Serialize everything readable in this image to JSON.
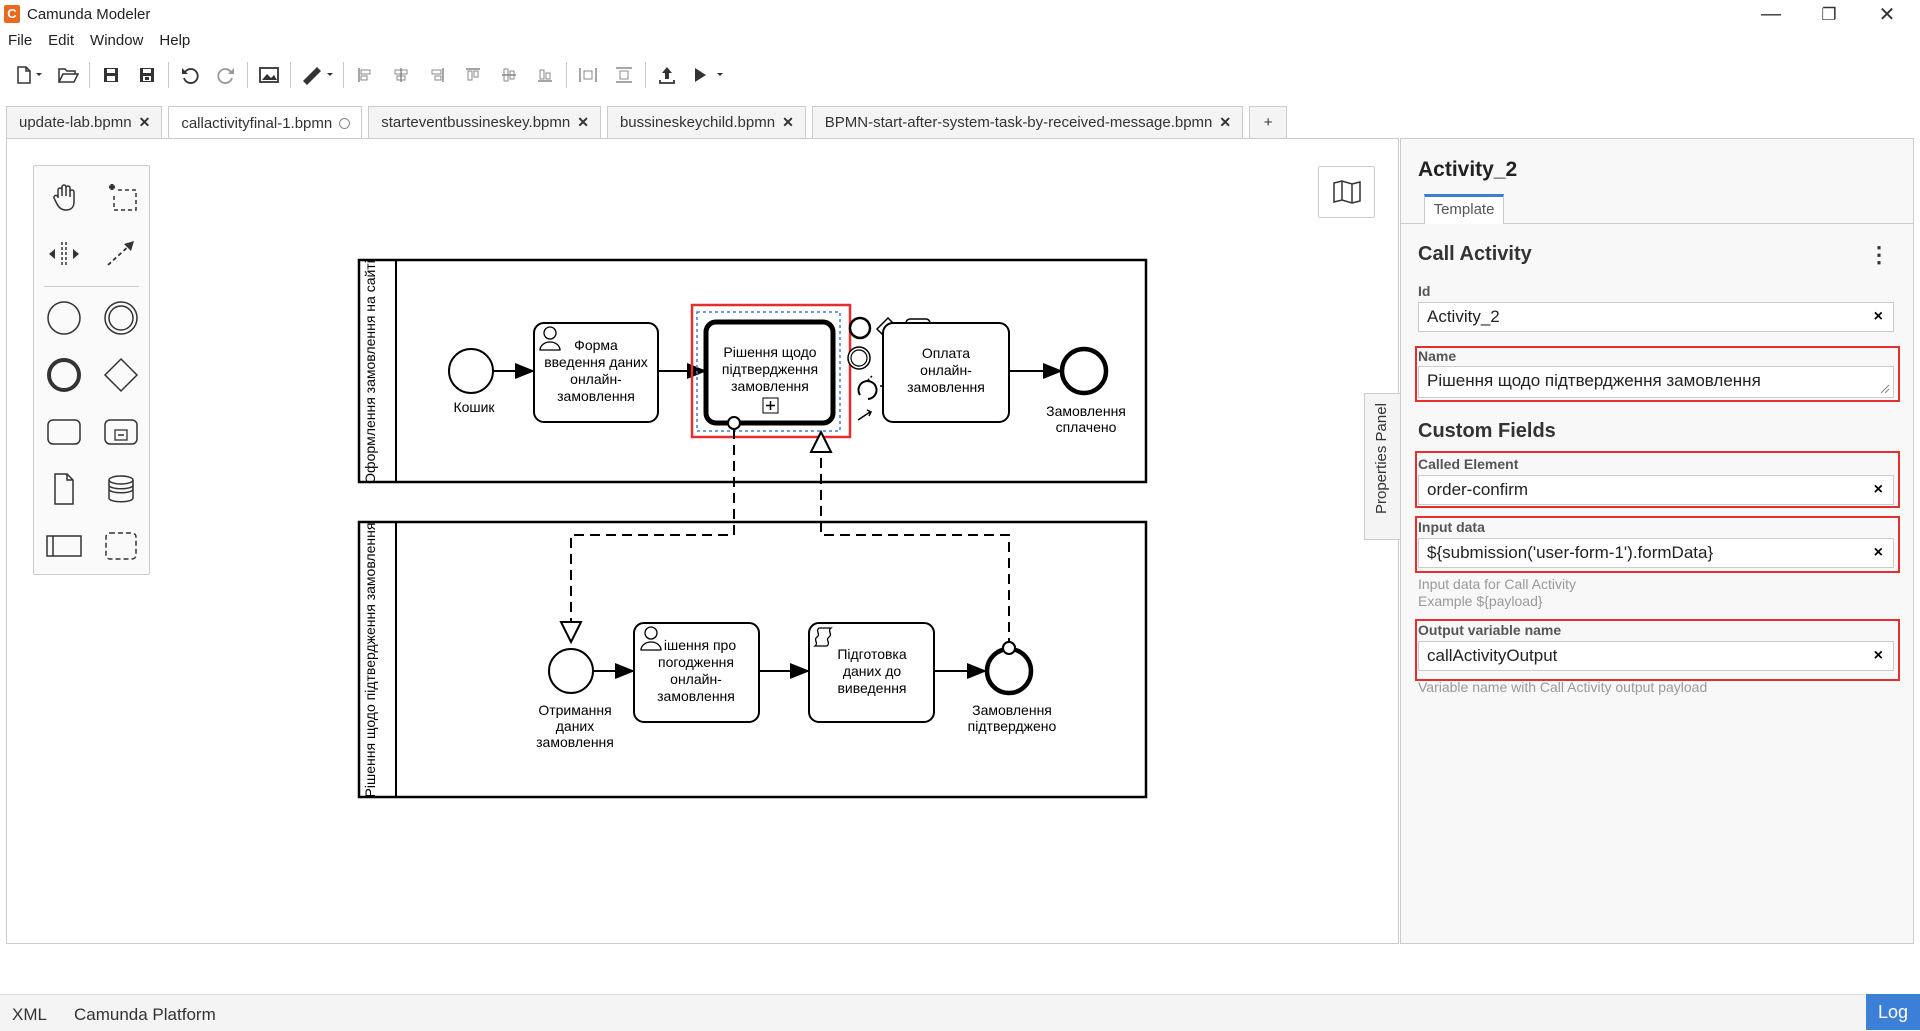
{
  "app": {
    "title": "Camunda Modeler",
    "logo_color": "#e96a1e"
  },
  "window_controls": {
    "minimize": "—",
    "maximize": "❐",
    "close": "✕"
  },
  "menu": {
    "items": [
      "File",
      "Edit",
      "Window",
      "Help"
    ]
  },
  "toolbar": {
    "icons": [
      "new-file-icon",
      "open-file-icon",
      "save-icon",
      "save-as-icon",
      "undo-icon",
      "redo-icon",
      "export-image-icon",
      "color-icon",
      "align-left-icon",
      "align-center-icon",
      "align-right-icon",
      "align-top-icon",
      "align-middle-icon",
      "align-bottom-icon",
      "distribute-horizontal-icon",
      "distribute-vertical-icon",
      "deploy-icon",
      "run-icon"
    ]
  },
  "tabs": [
    {
      "label": "update-lab.bpmn",
      "active": false,
      "dirty": false
    },
    {
      "label": "callactivityfinal-1.bpmn",
      "active": true,
      "dirty": true
    },
    {
      "label": "starteventbussineskey.bpmn",
      "active": false,
      "dirty": false
    },
    {
      "label": "bussineskeychild.bpmn",
      "active": false,
      "dirty": false
    },
    {
      "label": "BPMN-start-after-system-task-by-received-message.bpmn",
      "active": false,
      "dirty": false
    }
  ],
  "new_tab_label": "+",
  "diagram": {
    "pool1_label": "Оформлення замовлення на сайті",
    "pool2_label": "Рішення щодо підтвердження замовлення",
    "pool1": {
      "start_event": "Кошик",
      "user_task": [
        "Форма",
        "введення даних",
        "онлайн-",
        "замовлення"
      ],
      "call_activity": [
        "Рішення щодо",
        "підтвердження",
        "замовлення"
      ],
      "payment_task": [
        "Оплата",
        "онлайн-",
        "замовлення"
      ],
      "end_event": [
        "Замовлення",
        "сплачено"
      ]
    },
    "pool2": {
      "start_event": [
        "Отримання",
        "даних",
        "замовлення"
      ],
      "user_task": [
        "ішення про",
        "погодження",
        "онлайн-",
        "замовлення"
      ],
      "script_task": [
        "Підготовка",
        "даних до",
        "виведення"
      ],
      "end_event": [
        "Замовлення",
        "підтверджено"
      ]
    }
  },
  "properties_panel": {
    "toggle_label": "Properties Panel",
    "element_id_title": "Activity_2",
    "tab_label": "Template",
    "section_title": "Call Activity",
    "id_label": "Id",
    "id_value": "Activity_2",
    "name_label": "Name",
    "name_value": "Рішення щодо підтвердження замовлення",
    "custom_fields_title": "Custom Fields",
    "called_element_label": "Called Element",
    "called_element_value": "order-confirm",
    "input_data_label": "Input data",
    "input_data_value": "${submission('user-form-1').formData}",
    "input_data_hint_1": "Input data for Call Activity",
    "input_data_hint_2": "Example ${payload}",
    "output_var_label": "Output variable name",
    "output_var_value": "callActivityOutput",
    "output_var_hint": "Variable name with Call Activity output payload",
    "clear_symbol": "×",
    "menu_symbol": "⋮"
  },
  "statusbar": {
    "xml_label": "XML",
    "platform_label": "Camunda Platform",
    "log_label": "Log"
  },
  "colors": {
    "accent": "#3b7fd6",
    "highlight": "#e3302f"
  }
}
